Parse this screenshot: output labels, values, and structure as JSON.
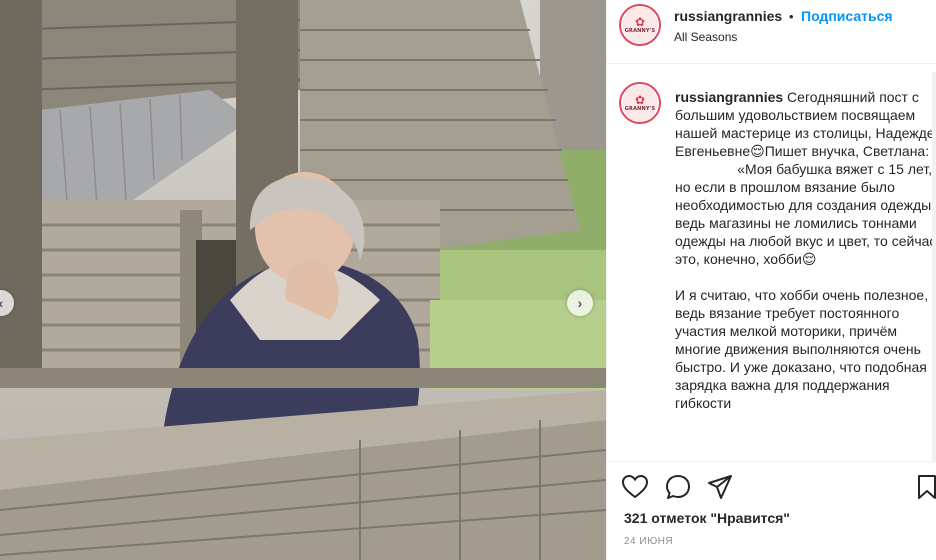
{
  "post": {
    "author": {
      "username": "russiangrannies",
      "avatar_brand": "GRANNY'S",
      "follow_label": "Подписаться",
      "separator": "•",
      "location": "All Seasons"
    },
    "caption": {
      "username": "russiangrannies",
      "text": " Сегодняшний пост с большим удовольствием посвящаем нашей мастерице из столицы, Надежде Евгеньевне😌Пишет внучка, Светлана:\n                «Моя бабушка вяжет с 15 лет, но если в прошлом вязание было необходимостью для создания одежды, ведь магазины не ломились тоннами одежды на любой вкус и цвет, то сейчас это, конечно, хобби😌\n\nИ я считаю, что хобби очень полезное, ведь вязание требует постоянного участия мелкой моторики, причём многие движения выполняются очень быстро. И уже доказано, что подобная зарядка важна для поддержания гибкости"
    },
    "likes_text": "321 отметок \"Нравится\"",
    "date_text": "24 ИЮНЯ",
    "accent_color": "#0095f6",
    "avatar_ring_color": "#e04a5f"
  },
  "icons": {
    "like": "heart-outline",
    "comment": "speech-bubble",
    "share": "paper-plane",
    "save": "bookmark",
    "prev": "chevron-left",
    "next": "chevron-right"
  }
}
